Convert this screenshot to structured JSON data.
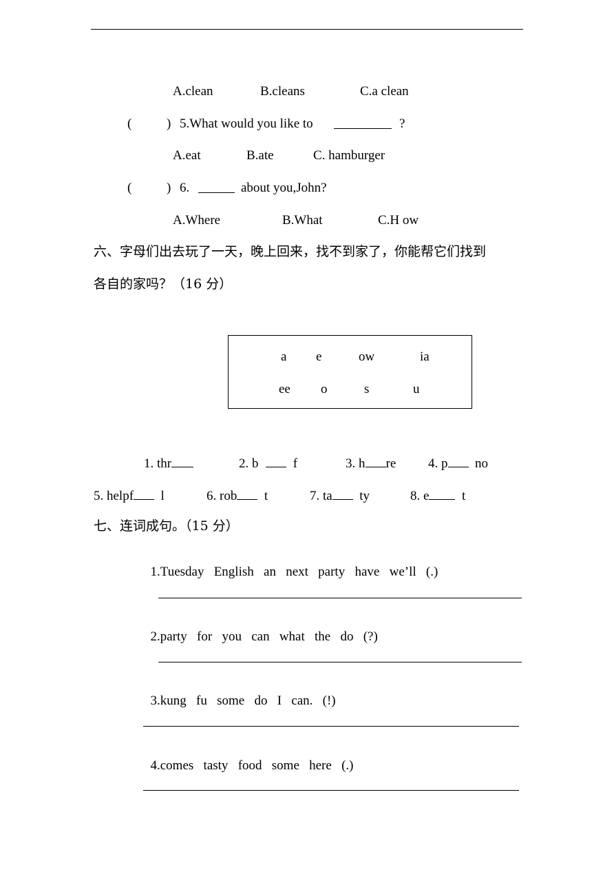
{
  "q4_options": [
    "A.clean",
    "B.cleans",
    "C.a clean"
  ],
  "q5": {
    "paren_open": "(",
    "paren_close": ")",
    "text": "5.What would you like to",
    "after": "?",
    "options": [
      "A.eat",
      "B.ate",
      "C. hamburger"
    ]
  },
  "q6": {
    "paren_open": "(",
    "paren_close": ")",
    "number": "6.",
    "text": "about you,John?",
    "options": [
      "A.Where",
      "B.What",
      "C.H ow"
    ]
  },
  "section6": {
    "title_line1": "六、字母们出去玩了一天，晚上回来，找不到家了，你能帮它们找到",
    "title_line2": "各自的家吗？（16 分）",
    "letters_row1": [
      "a",
      "e",
      "ow",
      "ia"
    ],
    "letters_row2": [
      "ee",
      "o",
      "s",
      "u"
    ],
    "items": [
      {
        "pre": "1. thr",
        "post": ""
      },
      {
        "pre": "2. b",
        "post": "f"
      },
      {
        "pre": "3. h",
        "post": "re"
      },
      {
        "pre": "4. p",
        "post": "no"
      },
      {
        "pre": "5. helpf",
        "post": "l"
      },
      {
        "pre": "6. rob",
        "post": "t"
      },
      {
        "pre": "7. ta",
        "post": "ty"
      },
      {
        "pre": "8. e",
        "post": "t"
      }
    ]
  },
  "section7": {
    "title": "七、连词成句。（15 分）",
    "items": [
      {
        "num": "1.",
        "words": [
          "Tuesday",
          "English",
          "an",
          "next",
          "party",
          "have",
          "we’ll",
          "(.)"
        ]
      },
      {
        "num": "2.",
        "words": [
          "party",
          "for",
          "you",
          "can",
          "what",
          "the",
          "do",
          "(?)"
        ]
      },
      {
        "num": "3.",
        "words": [
          "kung",
          "fu",
          "some",
          "do",
          "I",
          "can.",
          "(!)"
        ]
      },
      {
        "num": "4.",
        "words": [
          "comes",
          "tasty",
          "food",
          "some",
          "here",
          "(.)"
        ]
      }
    ]
  }
}
